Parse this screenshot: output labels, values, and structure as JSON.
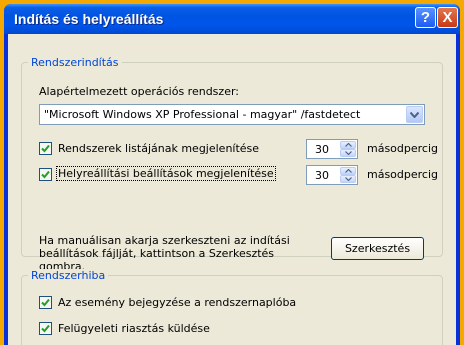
{
  "window": {
    "title": "Indítás és helyreállítás",
    "help_button": "?",
    "close_button": "X"
  },
  "startup": {
    "group_label": "Rendszerindítás",
    "default_os_label": "Alapértelmezett operációs rendszer:",
    "default_os_value": "\"Microsoft Windows XP Professional - magyar\" /fastdetect",
    "show_list": {
      "label": "Rendszerek listájának megjelenítése",
      "checked": true,
      "value": "30",
      "unit": "másodpercig"
    },
    "show_recovery": {
      "label": "Helyreállítási beállítások megjelenítése",
      "checked": true,
      "value": "30",
      "unit": "másodpercig"
    },
    "help_text": "Ha manuálisan akarja szerkeszteni az indítási\nbeállítások fájlját, kattintson a Szerkesztés\ngombra.",
    "edit_button": "Szerkesztés"
  },
  "system_failure": {
    "group_label": "Rendszerhiba",
    "log_event": {
      "label": "Az esemény bejegyzése a rendszernaplóba",
      "checked": true
    },
    "send_alert": {
      "label": "Felügyeleti riasztás küldése",
      "checked": true
    }
  },
  "colors": {
    "background": "#f5a800",
    "titlebar": "#0054e3",
    "dialog": "#ece9d8",
    "group_label": "#0046d5"
  }
}
